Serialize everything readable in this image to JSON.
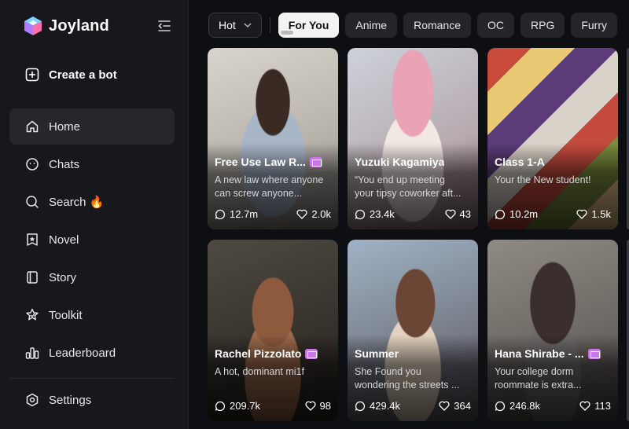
{
  "brand": {
    "name": "Joyland"
  },
  "sidebar": {
    "create_label": "Create a bot",
    "items": [
      {
        "label": "Home",
        "icon": "home-icon",
        "active": true
      },
      {
        "label": "Chats",
        "icon": "chat-smile-icon"
      },
      {
        "label": "Search 🔥",
        "icon": "search-icon"
      },
      {
        "label": "Novel",
        "icon": "novel-star-icon"
      },
      {
        "label": "Story",
        "icon": "story-book-icon"
      },
      {
        "label": "Toolkit",
        "icon": "toolkit-icon"
      },
      {
        "label": "Leaderboard",
        "icon": "leaderboard-icon"
      }
    ],
    "settings_label": "Settings"
  },
  "filters": {
    "sort": "Hot",
    "chips": [
      "For You",
      "Anime",
      "Romance",
      "OC",
      "RPG",
      "Furry"
    ],
    "active": "For You"
  },
  "cards": [
    {
      "name": "Free Use Law R...",
      "desc1": "A new law where anyone",
      "desc2": "can screw anyone...",
      "chats": "12.7m",
      "likes": "2.0k",
      "has_pic_badge": true
    },
    {
      "name": "Yuzuki Kagamiya",
      "desc1": "“You end up meeting",
      "desc2": "your tipsy coworker aft...",
      "chats": "23.4k",
      "likes": "43",
      "has_pic_badge": false
    },
    {
      "name": "Class 1-A",
      "desc1": "Your the New student!",
      "desc2": "",
      "chats": "10.2m",
      "likes": "1.5k",
      "has_pic_badge": false
    },
    {
      "name": "Rachel Pizzolato",
      "desc1": "A hot, dominant mi1f",
      "desc2": "",
      "chats": "209.7k",
      "likes": "98",
      "has_pic_badge": true
    },
    {
      "name": "Summer",
      "desc1": "She Found you",
      "desc2": "wondering the streets ...",
      "chats": "429.4k",
      "likes": "364",
      "has_pic_badge": false
    },
    {
      "name": "Hana Shirabe - ...",
      "desc1": "Your college dorm",
      "desc2": "roommate is extra...",
      "chats": "246.8k",
      "likes": "113",
      "has_pic_badge": true
    }
  ],
  "colors": {
    "background": "#0e0f12",
    "sidebar": "#17181c",
    "badge": "#c977e6"
  }
}
